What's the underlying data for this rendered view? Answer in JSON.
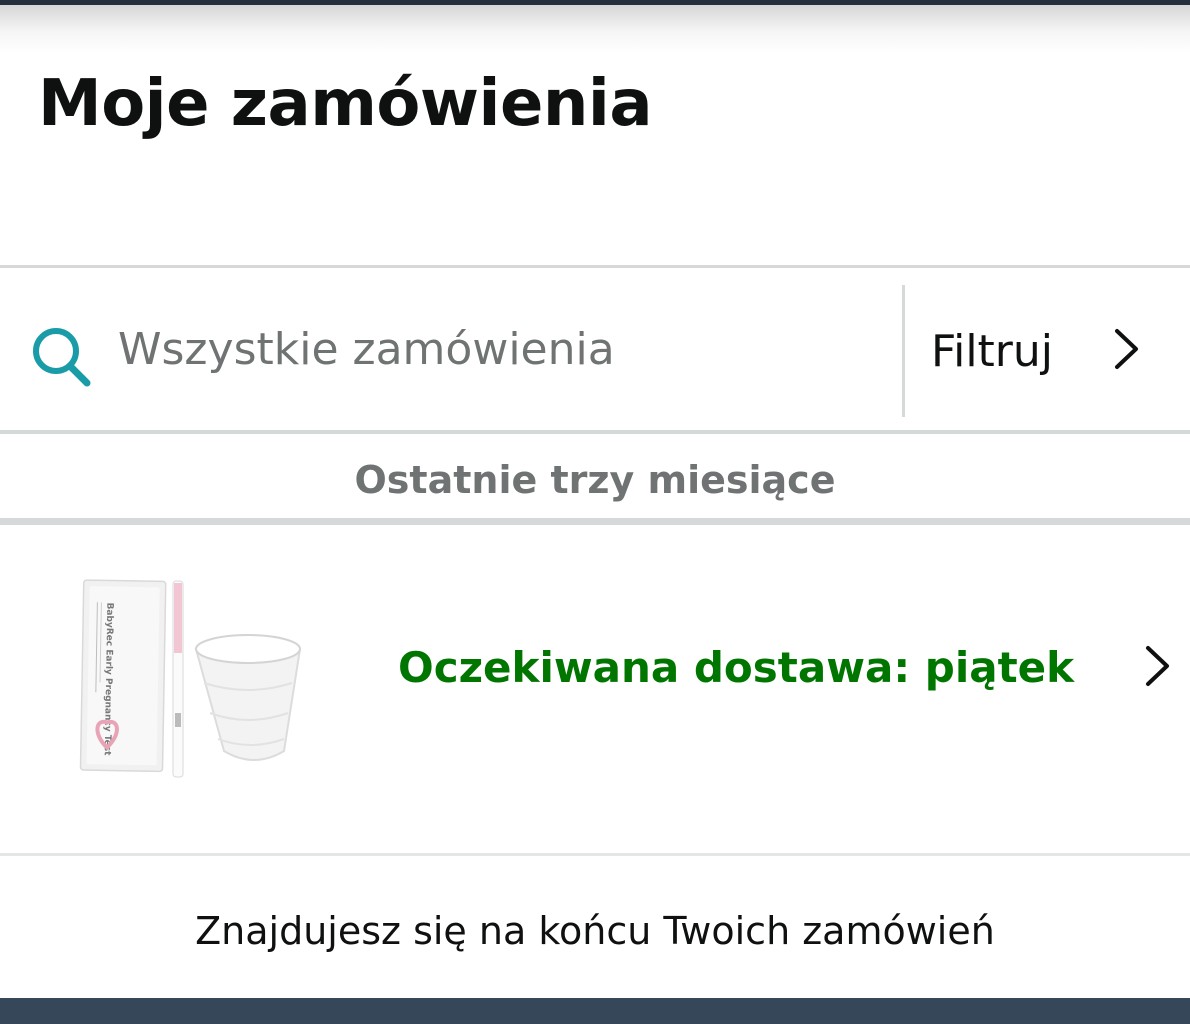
{
  "header": {
    "title": "Moje zamówienia"
  },
  "search": {
    "placeholder": "Wszystkie zamówienia",
    "icon": "search-icon",
    "icon_color": "#1a9ca8"
  },
  "filter": {
    "label": "Filtruj",
    "icon": "chevron-right-icon"
  },
  "orders_section": {
    "period_label": "Ostatnie trzy miesiące",
    "orders": [
      {
        "status": "Oczekiwana dostawa: piątek",
        "status_color": "#007600",
        "product_image": "pregnancy-test-kit-image",
        "product_image_text": "BabyRec Early Pregnancy Test",
        "icon": "chevron-right-icon"
      }
    ]
  },
  "footer": {
    "end_message": "Znajdujesz się na końcu Twoich zamówień"
  },
  "colors": {
    "text_primary": "#0f1111",
    "text_secondary": "#6f7373",
    "divider": "#d5d9d9",
    "nav_dark": "#232f3e",
    "bottom_bar": "#37475a"
  }
}
